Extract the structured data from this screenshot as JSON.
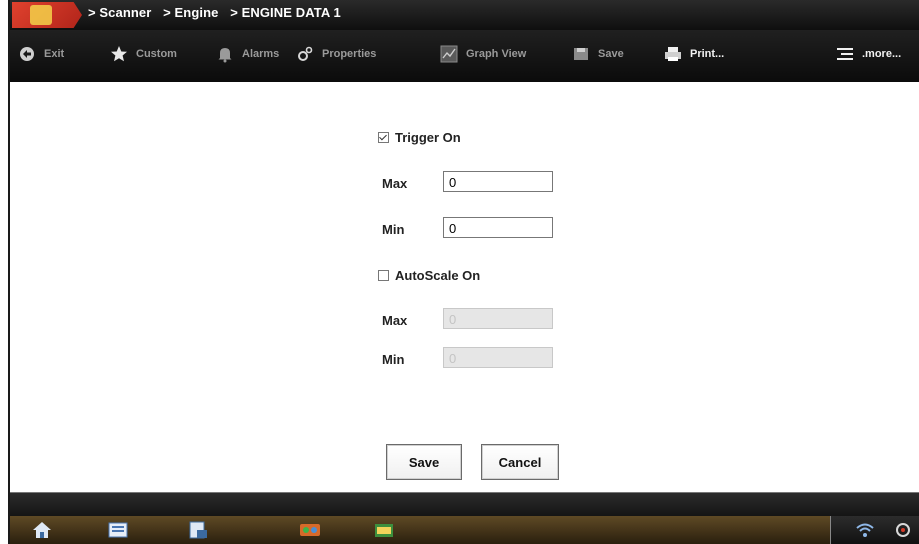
{
  "breadcrumb": {
    "items": [
      "> Scanner",
      "> Engine",
      "> ENGINE DATA 1"
    ]
  },
  "toolbar": {
    "exit": "Exit",
    "custom": "Custom",
    "alarms": "Alarms",
    "properties": "Properties",
    "graph_view": "Graph View",
    "save": "Save",
    "print": "Print...",
    "more": ".more..."
  },
  "form": {
    "trigger": {
      "label": "Trigger On",
      "checked": true
    },
    "trigger_max": {
      "label": "Max",
      "value": "0"
    },
    "trigger_min": {
      "label": "Min",
      "value": "0"
    },
    "autoscale": {
      "label": "AutoScale On",
      "checked": false
    },
    "autoscale_max": {
      "label": "Max",
      "value": "0"
    },
    "autoscale_min": {
      "label": "Min",
      "value": "0"
    }
  },
  "buttons": {
    "save": "Save",
    "cancel": "Cancel"
  },
  "colors": {
    "accent": "#d23a28",
    "toolbar_bg": "#111111"
  },
  "taskbar": {
    "icons": [
      "home-icon",
      "scanner-icon",
      "data-icon",
      "tools-icon",
      "folder-icon"
    ]
  }
}
